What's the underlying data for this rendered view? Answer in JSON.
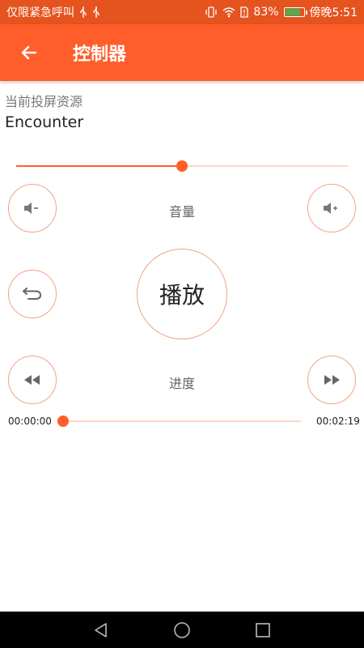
{
  "status_bar": {
    "carrier": "仅限紧急呼叫",
    "battery_percent": "83%",
    "battery_level": 0.83,
    "time": "傍晚5:51"
  },
  "app_bar": {
    "title": "控制器"
  },
  "source": {
    "label": "当前投屏资源",
    "value": "Encounter"
  },
  "volume": {
    "label": "音量",
    "level": 0.5
  },
  "controls": {
    "play_label": "播放"
  },
  "progress": {
    "label": "进度",
    "current_time": "00:00:00",
    "total_time": "00:02:19",
    "fraction": 0.0
  },
  "colors": {
    "status_bar": "#e5531f",
    "accent": "#ff5e2b",
    "track": "#fbd7c8",
    "button_border": "#f0a585"
  }
}
